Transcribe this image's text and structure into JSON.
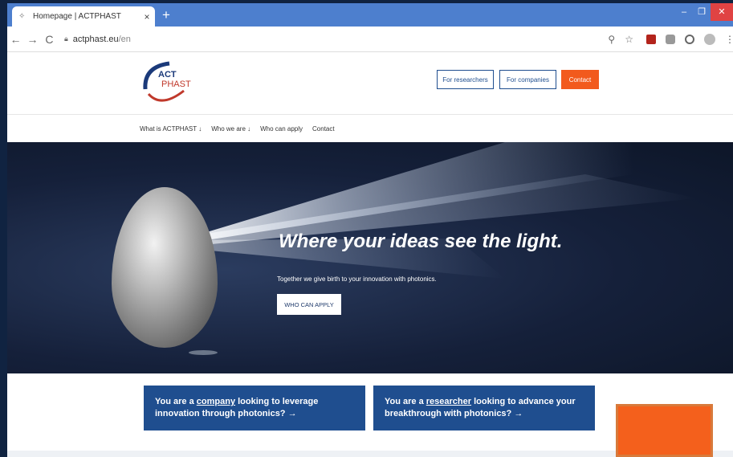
{
  "browser": {
    "tab_title": "Homepage | ACTPHAST",
    "tab_close": "×",
    "new_tab": "+",
    "url_host": "actphast.eu",
    "url_path": "/en",
    "win_minimize": "–",
    "win_restore": "❐",
    "win_close": "✕",
    "back": "←",
    "forward": "→",
    "reload": "C",
    "zoom_icon": "⚲",
    "star_icon": "☆",
    "menu": "⋮"
  },
  "header": {
    "logo_line1": "ACT",
    "logo_line2": "PHAST",
    "for_researchers": "For researchers",
    "for_companies": "For companies",
    "contact": "Contact"
  },
  "nav": {
    "items": [
      "What is ACTPHAST ↓",
      "Who we are ↓",
      "Who can apply",
      "Contact"
    ]
  },
  "hero": {
    "title": "Where your ideas see the light.",
    "subtitle": "Together we give birth to your innovation with photonics.",
    "button": "WHO CAN APPLY"
  },
  "cards": {
    "company": {
      "pre": "You are a ",
      "link": "company",
      "post": " looking to leverage innovation through photonics? →"
    },
    "researcher": {
      "pre": "You are a ",
      "link": "researcher",
      "post": " looking to advance your breakthrough with photonics? →"
    }
  },
  "colors": {
    "brand_blue": "#1f4e8f",
    "accent_orange": "#f25a1d",
    "chrome_blue": "#4d7fce"
  }
}
